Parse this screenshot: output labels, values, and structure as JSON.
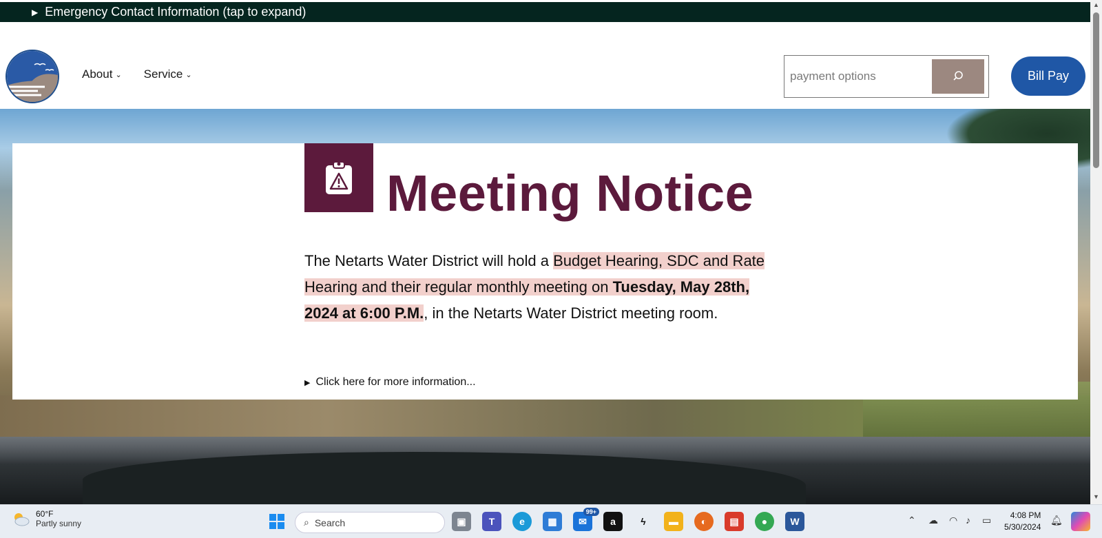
{
  "emergency": {
    "label": "Emergency Contact Information (tap to expand)"
  },
  "nav": {
    "items": [
      {
        "label": "About"
      },
      {
        "label": "Service"
      }
    ]
  },
  "search": {
    "placeholder": "payment options"
  },
  "bill_pay": {
    "label": "Bill Pay"
  },
  "notice": {
    "title": "Meeting Notice",
    "body_pre": "The Netarts Water District will hold a ",
    "body_highlight": "Budget Hearing, SDC and Rate Hearing and their regular monthly meeting on ",
    "body_bold": "Tuesday, May 28th, 2024 at 6:00 P.M.",
    "body_post": ", in the Netarts Water District meeting room.",
    "more_info": "Click here for more information..."
  },
  "taskbar": {
    "weather_temp": "60°F",
    "weather_desc": "Partly sunny",
    "search_label": "Search",
    "mail_badge": "99+",
    "time": "4:08 PM",
    "date": "5/30/2024"
  },
  "colors": {
    "emergency_bg": "#05251f",
    "notice_accent": "#5c1a3c",
    "highlight": "#f2d0cc",
    "bill_pay_bg": "#1f57a6",
    "search_button": "#9c8880"
  }
}
